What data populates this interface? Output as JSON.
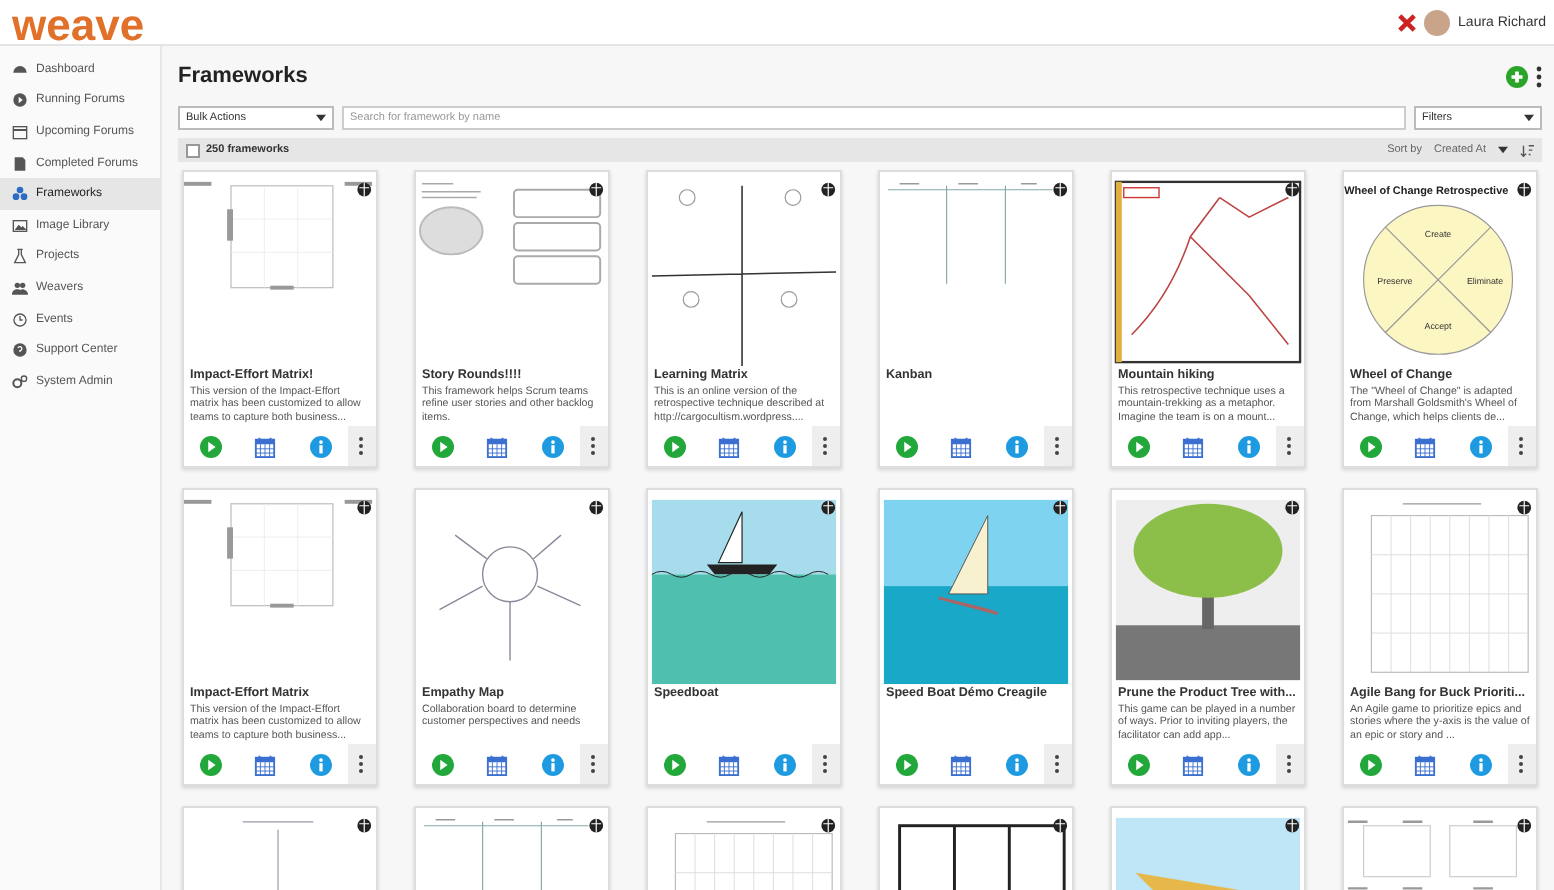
{
  "header": {
    "logo": "weave",
    "user_name": "Laura Richard"
  },
  "sidebar": {
    "items": [
      {
        "label": "Dashboard",
        "selected": false
      },
      {
        "label": "Running Forums",
        "selected": false
      },
      {
        "label": "Upcoming Forums",
        "selected": false
      },
      {
        "label": "Completed Forums",
        "selected": false
      },
      {
        "label": "Frameworks",
        "selected": true
      },
      {
        "label": "Image Library",
        "selected": false
      },
      {
        "label": "Projects",
        "selected": false
      },
      {
        "label": "Weavers",
        "selected": false
      },
      {
        "label": "Events",
        "selected": false
      },
      {
        "label": "Support Center",
        "selected": false
      },
      {
        "label": "System Admin",
        "selected": false
      }
    ]
  },
  "page": {
    "title": "Frameworks",
    "bulk_actions": "Bulk Actions",
    "search": {
      "placeholder": "Search for framework by name"
    },
    "filters": "Filters",
    "count": "250 frameworks",
    "select_all_checked": false,
    "sort_label": "Sort by",
    "sort_value": "Created At"
  },
  "cards": [
    {
      "title": "Impact-Effort Matrix!",
      "description": "This version of the Impact-Effort matrix has been customized to allow teams to capture both business...",
      "kind": "whiteboard"
    },
    {
      "title": "Story Rounds!!!!",
      "description": "This framework helps Scrum teams refine user stories and other backlog items.",
      "kind": "story"
    },
    {
      "title": "Learning Matrix",
      "description": "This is an online version of the retrospective technique described at http://cargocultism.wordpress....",
      "kind": "matrix"
    },
    {
      "title": "Kanban",
      "kind": "kanban"
    },
    {
      "title": "Mountain hiking",
      "description": "This retrospective technique uses a mountain-trekking as a metaphor. Imagine the team is on a mount...",
      "kind": "mountain"
    },
    {
      "title": "Wheel of Change",
      "description": "The \"Wheel of Change\" is adapted from Marshall Goldsmith's Wheel of Change, which helps clients de...",
      "kind": "wheel",
      "thumb_title": "Wheel of Change Retrospective",
      "thumb_labels": [
        "Create",
        "Preserve",
        "Eliminate",
        "Accept"
      ]
    },
    {
      "title": "Impact-Effort Matrix",
      "description": "This version of the Impact-Effort matrix has been customized to allow teams to capture both business...",
      "kind": "whiteboard"
    },
    {
      "title": "Empathy Map",
      "description": "Collaboration board to determine customer perspectives and needs",
      "kind": "empathy"
    },
    {
      "title": "Speedboat",
      "kind": "sailboat"
    },
    {
      "title": "Speed Boat Démo Creagile",
      "kind": "sailing"
    },
    {
      "title": "Prune the Product Tree with...",
      "description": "This game can be played in a number of ways. Prior to inviting players, the facilitator can add app...",
      "kind": "tree"
    },
    {
      "title": "Agile Bang for Buck Prioriti...",
      "description": "An Agile game to prioritize epics and stories where the y-axis is the value of an epic or story and ...",
      "kind": "graph"
    },
    {
      "kind": "axes"
    },
    {
      "kind": "kanban"
    },
    {
      "kind": "graph"
    },
    {
      "kind": "frame"
    },
    {
      "kind": "speedboat"
    },
    {
      "kind": "boards"
    }
  ]
}
